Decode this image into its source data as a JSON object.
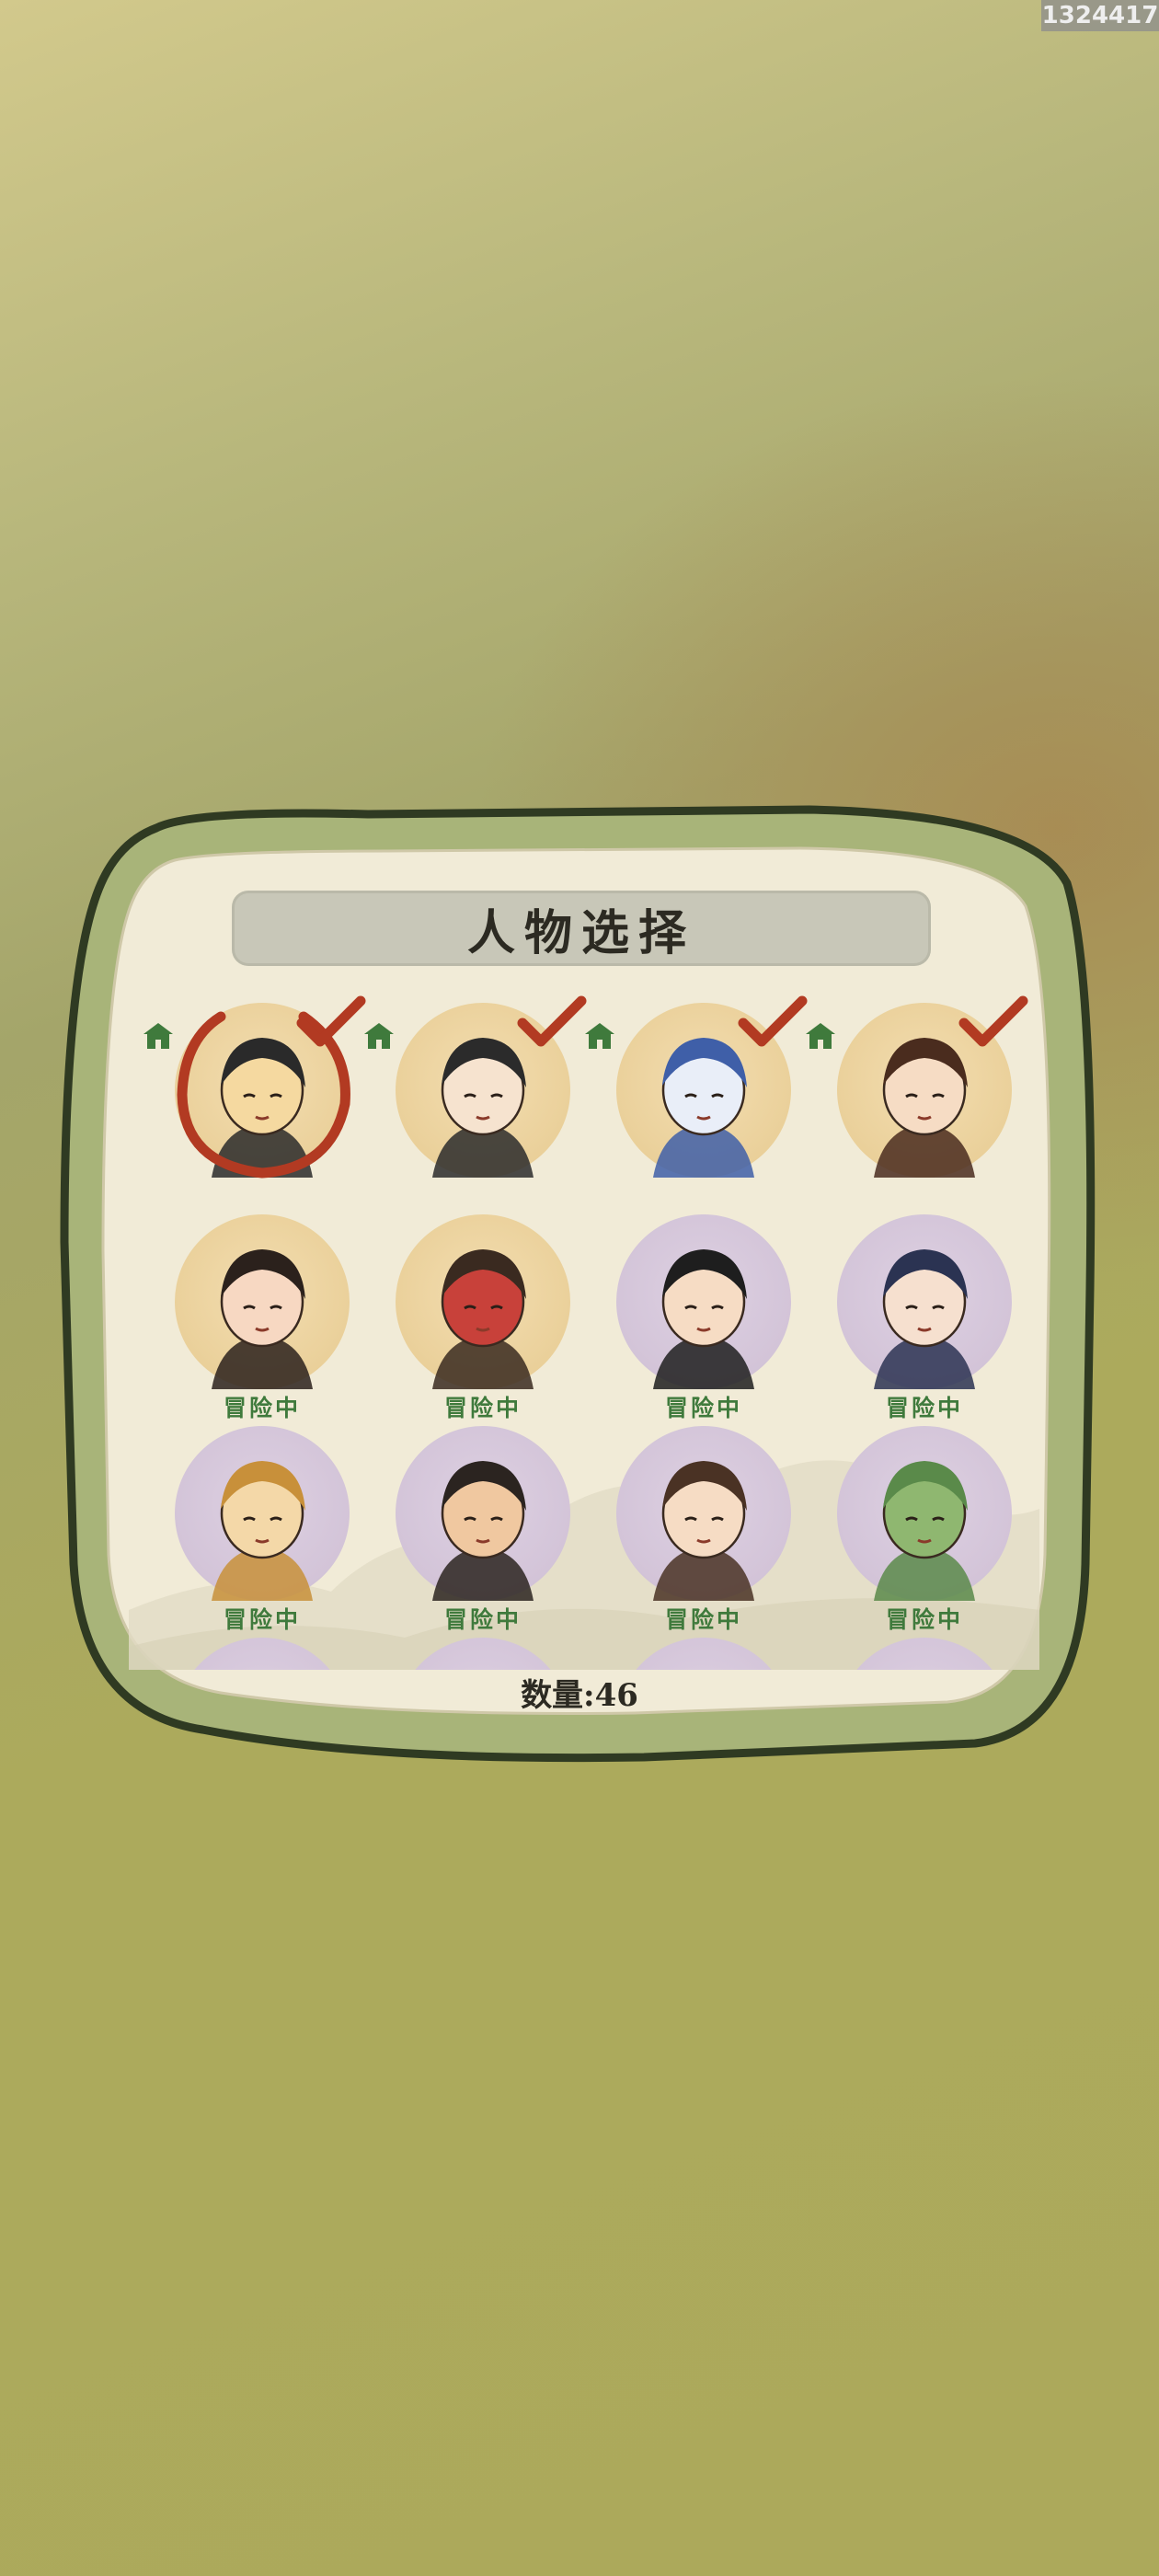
{
  "session_id": "1324417",
  "panel": {
    "title": "人物选择",
    "count_label": "数量:46"
  },
  "colors": {
    "status_green": "#3f7a3c",
    "check_red": "#b23a22",
    "frame_green": "#a9b77a"
  },
  "characters": [
    {
      "name": "raven-warrior",
      "bg": "yellow",
      "selected": true,
      "status": "",
      "checked": true,
      "home": true
    },
    {
      "name": "white-haired-swordsman",
      "bg": "yellow",
      "selected": false,
      "status": "",
      "checked": true,
      "home": true
    },
    {
      "name": "blue-dragon",
      "bg": "yellow",
      "selected": false,
      "status": "",
      "checked": true,
      "home": true
    },
    {
      "name": "noble-lady",
      "bg": "yellow",
      "selected": false,
      "status": "",
      "checked": true,
      "home": true
    },
    {
      "name": "nezha-child",
      "bg": "yellow",
      "selected": false,
      "status": "冒险中",
      "checked": false,
      "home": false
    },
    {
      "name": "red-faced-general",
      "bg": "yellow",
      "selected": false,
      "status": "冒险中",
      "checked": false,
      "home": false
    },
    {
      "name": "scholar-black-hat",
      "bg": "purple",
      "selected": false,
      "status": "冒险中",
      "checked": false,
      "home": false
    },
    {
      "name": "smiling-maiden",
      "bg": "purple",
      "selected": false,
      "status": "冒险中",
      "checked": false,
      "home": false
    },
    {
      "name": "monkey-king",
      "bg": "purple",
      "selected": false,
      "status": "冒险中",
      "checked": false,
      "home": false
    },
    {
      "name": "bearded-elder",
      "bg": "purple",
      "selected": false,
      "status": "冒险中",
      "checked": false,
      "home": false
    },
    {
      "name": "girl-hair-buns",
      "bg": "purple",
      "selected": false,
      "status": "冒险中",
      "checked": false,
      "home": false
    },
    {
      "name": "green-fish-creature",
      "bg": "purple",
      "selected": false,
      "status": "冒险中",
      "checked": false,
      "home": false
    },
    {
      "name": "partial-row-1",
      "bg": "purple",
      "selected": false,
      "status": "",
      "checked": false,
      "home": false
    },
    {
      "name": "partial-row-2",
      "bg": "purple",
      "selected": false,
      "status": "",
      "checked": false,
      "home": false
    },
    {
      "name": "partial-row-3",
      "bg": "purple",
      "selected": false,
      "status": "",
      "checked": false,
      "home": false
    },
    {
      "name": "partial-row-4",
      "bg": "purple",
      "selected": false,
      "status": "",
      "checked": false,
      "home": false
    }
  ]
}
